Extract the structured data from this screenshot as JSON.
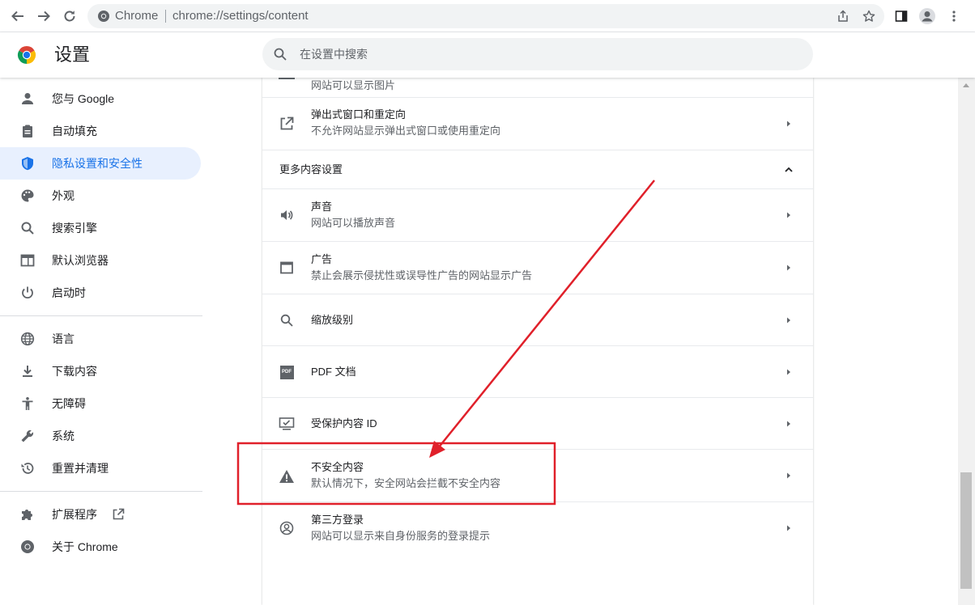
{
  "browser": {
    "site_chip": "Chrome",
    "url": "chrome://settings/content"
  },
  "header": {
    "title": "设置",
    "search_placeholder": "在设置中搜索"
  },
  "sidebar": {
    "items": [
      {
        "label": "您与 Google",
        "icon": "person-icon"
      },
      {
        "label": "自动填充",
        "icon": "clipboard-icon"
      },
      {
        "label": "隐私设置和安全性",
        "icon": "shield-icon"
      },
      {
        "label": "外观",
        "icon": "palette-icon"
      },
      {
        "label": "搜索引擎",
        "icon": "search-icon"
      },
      {
        "label": "默认浏览器",
        "icon": "browser-icon"
      },
      {
        "label": "启动时",
        "icon": "power-icon"
      },
      {
        "label": "语言",
        "icon": "globe-icon"
      },
      {
        "label": "下载内容",
        "icon": "download-icon"
      },
      {
        "label": "无障碍",
        "icon": "accessibility-icon"
      },
      {
        "label": "系统",
        "icon": "wrench-icon"
      },
      {
        "label": "重置并清理",
        "icon": "history-icon"
      },
      {
        "label": "扩展程序",
        "icon": "puzzle-icon"
      },
      {
        "label": "关于 Chrome",
        "icon": "chrome-icon"
      }
    ],
    "active_index": 2
  },
  "content": {
    "partial_row_sub": "网站可以显示图片",
    "popups": {
      "title": "弹出式窗口和重定向",
      "subtitle": "不允许网站显示弹出式窗口或使用重定向"
    },
    "more_section": "更多内容设置",
    "sound": {
      "title": "声音",
      "subtitle": "网站可以播放声音"
    },
    "ads": {
      "title": "广告",
      "subtitle": "禁止会展示侵扰性或误导性广告的网站显示广告"
    },
    "zoom": {
      "title": "缩放级别"
    },
    "pdf": {
      "title": "PDF 文档",
      "icon_text": "PDF"
    },
    "protected": {
      "title": "受保护内容 ID"
    },
    "insecure": {
      "title": "不安全内容",
      "subtitle": "默认情况下，安全网站会拦截不安全内容"
    },
    "federated": {
      "title": "第三方登录",
      "subtitle": "网站可以显示来自身份服务的登录提示"
    }
  },
  "colors": {
    "accent": "#1a73e8",
    "active_bg": "#e8f0fe",
    "annotation": "#e0202a"
  }
}
